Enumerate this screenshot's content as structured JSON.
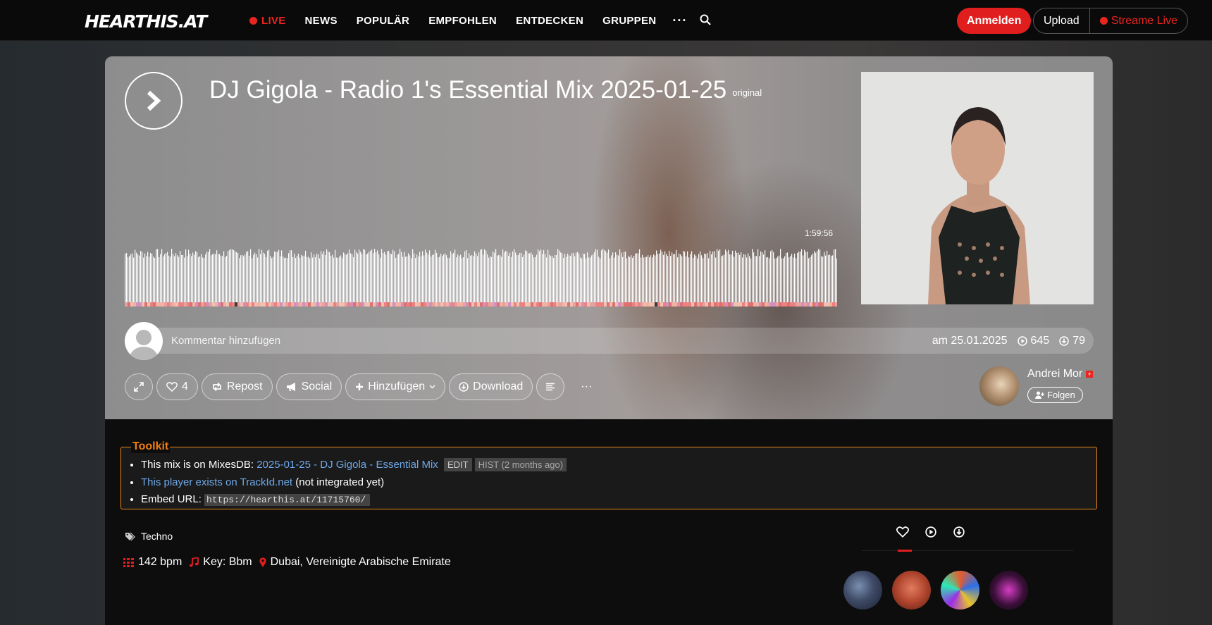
{
  "header": {
    "logo": "HEARTHIS.AT",
    "nav": [
      "LIVE",
      "NEWS",
      "POPULÄR",
      "EMPFOHLEN",
      "ENTDECKEN",
      "GRUPPEN",
      "···"
    ],
    "login_label": "Anmelden",
    "upload_label": "Upload",
    "stream_label": "Streame Live",
    "accent_color": "#e01e1e"
  },
  "track": {
    "title": "DJ Gigola - Radio 1's Essential Mix 2025-01-25",
    "tag": "original",
    "duration": "1:59:56",
    "comment_placeholder": "Kommentar hinzufügen",
    "date": "am 25.01.2025",
    "plays": "645",
    "downloads": "79"
  },
  "actions": {
    "likes": "4",
    "repost": "Repost",
    "social": "Social",
    "add": "Hinzufügen",
    "download": "Download",
    "more": "···"
  },
  "artist": {
    "name": "Andrei Mor",
    "follow": "Folgen"
  },
  "toolkit": {
    "legend": "Toolkit",
    "mixesdb_prefix": "This mix is on MixesDB:",
    "mixesdb_link": "2025-01-25 - DJ Gigola - Essential Mix",
    "edit": "EDIT",
    "hist": "HIST (2 months ago)",
    "trackid_link": "This player exists on TrackId.net",
    "trackid_suffix": "(not integrated yet)",
    "embed_prefix": "Embed URL:",
    "embed_url": "https://hearthis.at/11715760/"
  },
  "details": {
    "genre": "Techno",
    "bpm": "142 bpm",
    "key": "Key: Bbm",
    "location": "Dubai, Vereinigte Arabische Emirate"
  },
  "icons": [
    "search-icon",
    "play-icon",
    "expand-icon",
    "heart-icon",
    "repost-icon",
    "megaphone-icon",
    "plus-icon",
    "download-icon",
    "list-icon",
    "user-plus-icon",
    "tag-icon",
    "bpm-icon",
    "music-icon",
    "map-pin-icon"
  ]
}
